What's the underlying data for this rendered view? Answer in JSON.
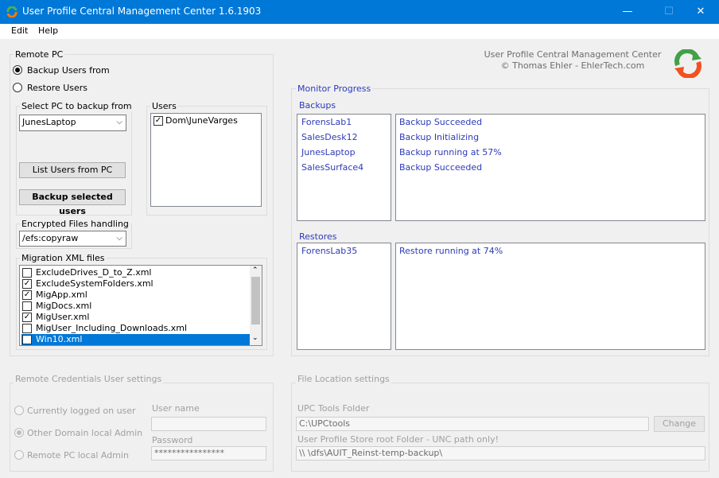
{
  "window": {
    "title": "User Profile Central Management Center 1.6.1903",
    "minimize": "—",
    "maximize": "☐",
    "close": "✕"
  },
  "menu": [
    "Edit",
    "Help"
  ],
  "about": {
    "line1": "User Profile Central Management Center",
    "line2": "© Thomas Ehler - EhlerTech.com"
  },
  "remote_pc": {
    "title": "Remote PC",
    "backup_radio": "Backup Users from",
    "restore_radio": "Restore Users",
    "select_pc_title": "Select PC to backup from",
    "selected_pc": "JunesLaptop",
    "list_users_button": "List Users from PC",
    "backup_button": "Backup selected users",
    "users_title": "Users",
    "users": [
      {
        "label": "Dom\\JuneVarges",
        "checked": true
      }
    ],
    "efs_title": "Encrypted Files handling",
    "efs_value": "/efs:copyraw",
    "xml_title": "Migration XML files",
    "xml_files": [
      {
        "label": "ExcludeDrives_D_to_Z.xml",
        "checked": false
      },
      {
        "label": "ExcludeSystemFolders.xml",
        "checked": true
      },
      {
        "label": "MigApp.xml",
        "checked": true
      },
      {
        "label": "MigDocs.xml",
        "checked": false
      },
      {
        "label": "MigUser.xml",
        "checked": true
      },
      {
        "label": "MigUser_Including_Downloads.xml",
        "checked": false
      },
      {
        "label": "Win10.xml",
        "checked": true
      }
    ]
  },
  "monitor": {
    "title": "Monitor Progress",
    "backups_title": "Backups",
    "backups": [
      {
        "pc": "ForensLab1",
        "status": "Backup Succeeded"
      },
      {
        "pc": "SalesDesk12",
        "status": "Backup Initializing"
      },
      {
        "pc": "JunesLaptop",
        "status": "Backup running at 57%"
      },
      {
        "pc": "SalesSurface4",
        "status": "Backup Succeeded"
      }
    ],
    "restores_title": "Restores",
    "restores": [
      {
        "pc": "ForensLab35",
        "status": "Restore running at 74%"
      }
    ]
  },
  "credentials": {
    "title": "Remote Credentials User settings",
    "options": [
      "Currently logged on user",
      "Other Domain local Admin",
      "Remote PC local Admin"
    ],
    "username_label": "User name",
    "username_value": "",
    "password_label": "Password",
    "password_value": "****************"
  },
  "file_location": {
    "title": "File Location settings",
    "tools_label": "UPC Tools Folder",
    "tools_value": "C:\\UPCtools",
    "change_button": "Change",
    "store_label": "User Profile Store root Folder - UNC path only!",
    "store_value": "\\\\          \\dfs\\AUIT_Reinst-temp-backup\\"
  }
}
